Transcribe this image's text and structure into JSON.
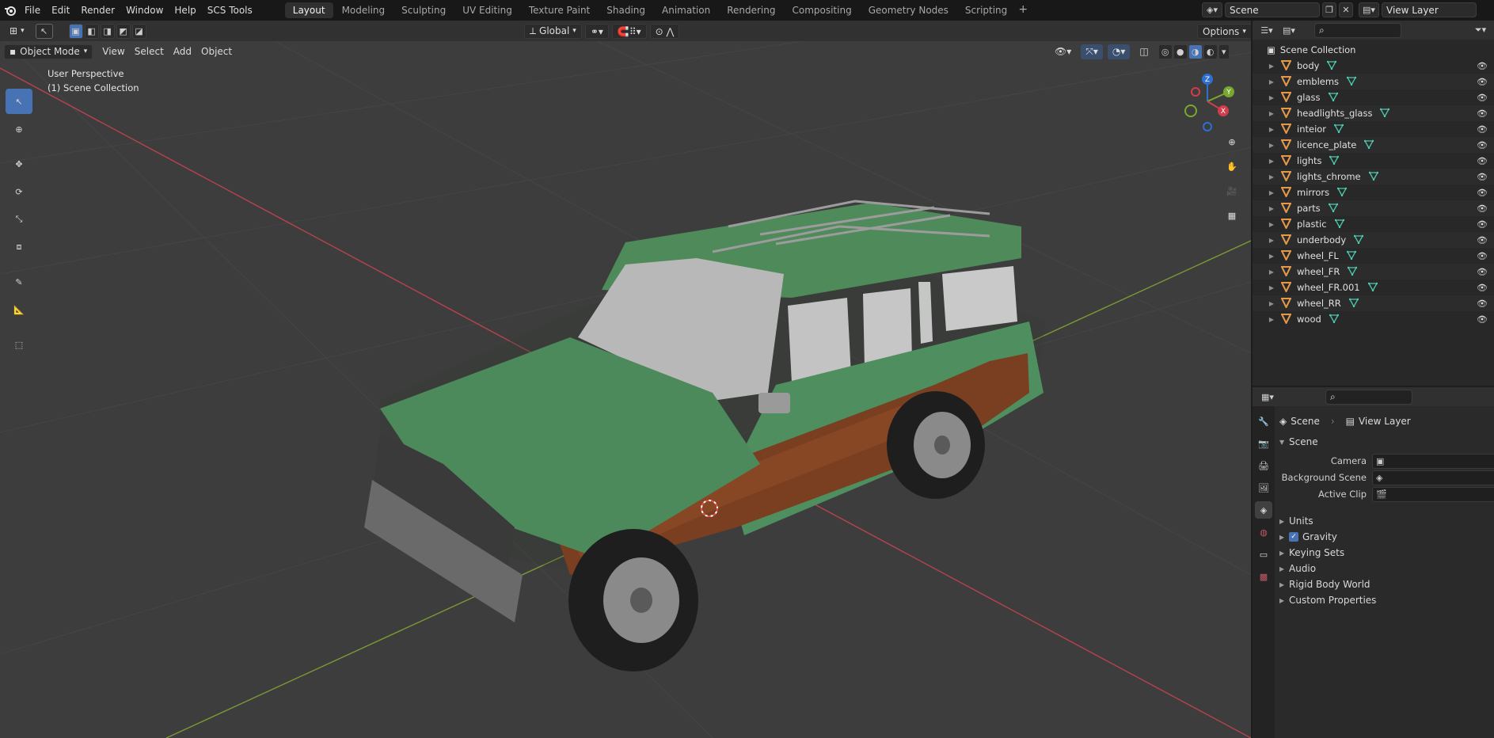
{
  "topbar": {
    "menus": [
      "File",
      "Edit",
      "Render",
      "Window",
      "Help",
      "SCS Tools"
    ],
    "workspaces": [
      "Layout",
      "Modeling",
      "Sculpting",
      "UV Editing",
      "Texture Paint",
      "Shading",
      "Animation",
      "Rendering",
      "Compositing",
      "Geometry Nodes",
      "Scripting"
    ],
    "active_workspace": "Layout",
    "scene_name": "Scene",
    "view_layer": "View Layer"
  },
  "viewport": {
    "mode": "Object Mode",
    "menus": [
      "View",
      "Select",
      "Add",
      "Object"
    ],
    "transform_orientation": "Global",
    "options_label": "Options",
    "info_line1": "User Perspective",
    "info_line2": "(1) Scene Collection",
    "gizmo_axes": {
      "z": "Z",
      "y": "Y",
      "x": "X"
    },
    "colors": {
      "bg": "#3d3d3d",
      "grid": "#454545",
      "x_axis": "#b8434f",
      "y_axis": "#7a9a33",
      "accent": "#4772b3"
    }
  },
  "outliner": {
    "root": "Scene Collection",
    "objects": [
      "body",
      "emblems",
      "glass",
      "headlights_glass",
      "inteior",
      "licence_plate",
      "lights",
      "lights_chrome",
      "mirrors",
      "parts",
      "plastic",
      "underbody",
      "wheel_FL",
      "wheel_FR",
      "wheel_FR.001",
      "wheel_RR",
      "wood"
    ]
  },
  "properties": {
    "breadcrumb_scene": "Scene",
    "breadcrumb_layer": "View Layer",
    "panel_title": "Scene",
    "camera_label": "Camera",
    "background_scene_label": "Background Scene",
    "active_clip_label": "Active Clip",
    "sections": [
      "Units",
      "Gravity",
      "Keying Sets",
      "Audio",
      "Rigid Body World",
      "Custom Properties"
    ],
    "gravity_checked": true
  }
}
